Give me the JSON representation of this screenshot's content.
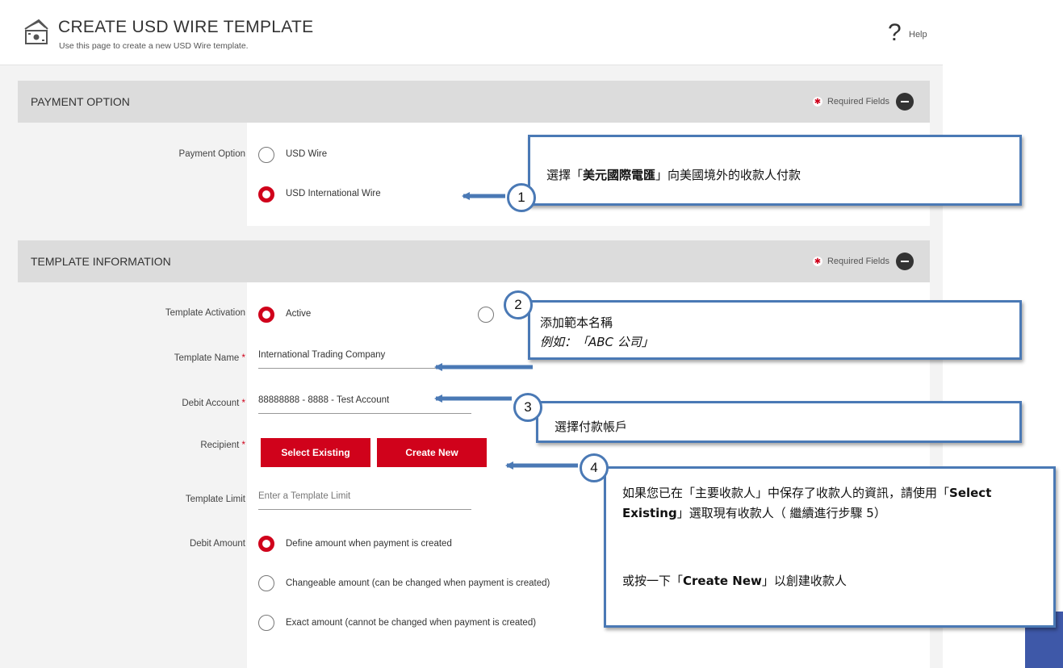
{
  "header": {
    "title": "CREATE USD WIRE TEMPLATE",
    "subtitle": "Use this page to create a new USD Wire template.",
    "help_icon": "?",
    "help_label": "Help"
  },
  "payment_option": {
    "section_title": "PAYMENT OPTION",
    "required_label": "Required Fields",
    "field_label": "Payment Option",
    "options": [
      "USD Wire",
      "USD International Wire"
    ],
    "selected": "USD International Wire"
  },
  "template_info": {
    "section_title": "TEMPLATE INFORMATION",
    "required_label": "Required Fields",
    "activation_label": "Template Activation",
    "activation_option": "Active",
    "name_label": "Template Name",
    "name_value": "International Trading Company",
    "debit_account_label": "Debit Account",
    "debit_account_value": "88888888 - 8888 - Test Account",
    "recipient_label": "Recipient",
    "select_existing_label": "Select Existing",
    "create_new_label": "Create New",
    "limit_label": "Template Limit",
    "limit_placeholder": "Enter a Template Limit",
    "debit_amount_label": "Debit Amount",
    "amount_options": [
      "Define amount when payment is created",
      "Changeable amount (can be changed when payment is created)",
      "Exact amount (cannot be changed when payment is created)"
    ],
    "star": "*"
  },
  "callouts": [
    {
      "number": "1",
      "text_pre": "選擇「",
      "text_bold": "美元國際電匯",
      "text_post": "」向美國境外的收款人付款"
    },
    {
      "number": "2",
      "line1": "添加範本名稱",
      "line2": "例如：「ABC 公司」"
    },
    {
      "number": "3",
      "text": "選擇付款帳戶"
    },
    {
      "number": "4",
      "p1_pre": "如果您已在「主要收款人」中保存了收款人的資訊，請使用「",
      "p1_bold": "Select Existing",
      "p1_post": "」選取現有收款人（ 繼續進行步驟 5）",
      "p2_pre": "或按一下「",
      "p2_bold": "Create New",
      "p2_post": "」以創建收款人"
    }
  ],
  "colors": {
    "accent": "#d0021b",
    "callout_border": "#4a79b5",
    "corner_block": "#3e58a8"
  }
}
